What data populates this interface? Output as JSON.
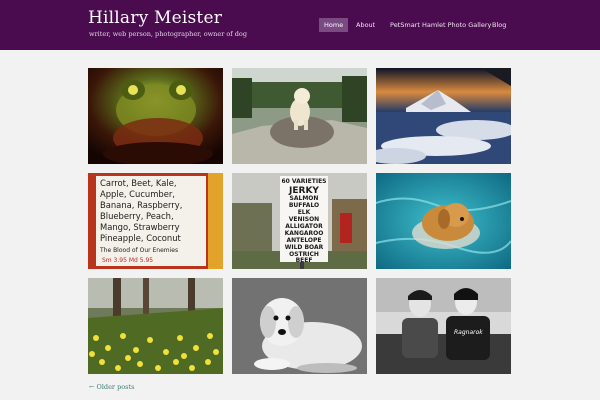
{
  "site": {
    "title": "Hillary Meister",
    "tagline": "writer, web person, photographer, owner of dog"
  },
  "nav": {
    "items": [
      {
        "label": "Home",
        "active": true
      },
      {
        "label": "About",
        "active": false
      },
      {
        "label": "PetSmart Hamlet Photo Gallery",
        "active": false
      },
      {
        "label": "Blog",
        "active": false
      }
    ]
  },
  "gallery": {
    "photos": [
      {
        "subject": "frog figurine lamp"
      },
      {
        "subject": "golden retriever on rock"
      },
      {
        "subject": "snowy mountain above clouds"
      },
      {
        "subject": "handwritten juice menu",
        "menu_text": [
          "Carrot, Beet, Kale,",
          "Apple, Cucumber,",
          "Banana, Raspberry,",
          "Blueberry, Peach,",
          "Mango, Strawberry",
          "Pineapple, Coconut",
          "The Blood of Our Enemies",
          "Sm 3.95   Md 5.95"
        ]
      },
      {
        "subject": "jerky roadside sign",
        "sign_text": [
          "60 VARIETIES",
          "JERKY",
          "SALMON",
          "BUFFALO",
          "ELK",
          "VENISON",
          "ALLIGATOR",
          "KANGAROO",
          "ANTELOPE",
          "WILD BOAR",
          "OSTRICH",
          "BEEF"
        ]
      },
      {
        "subject": "golden retriever swimming"
      },
      {
        "subject": "field of daffodils"
      },
      {
        "subject": "golden retriever black and white"
      },
      {
        "subject": "two young men portrait",
        "shirt_text": "Ragnarok"
      }
    ]
  },
  "pagination": {
    "older_label": "← Older posts"
  }
}
